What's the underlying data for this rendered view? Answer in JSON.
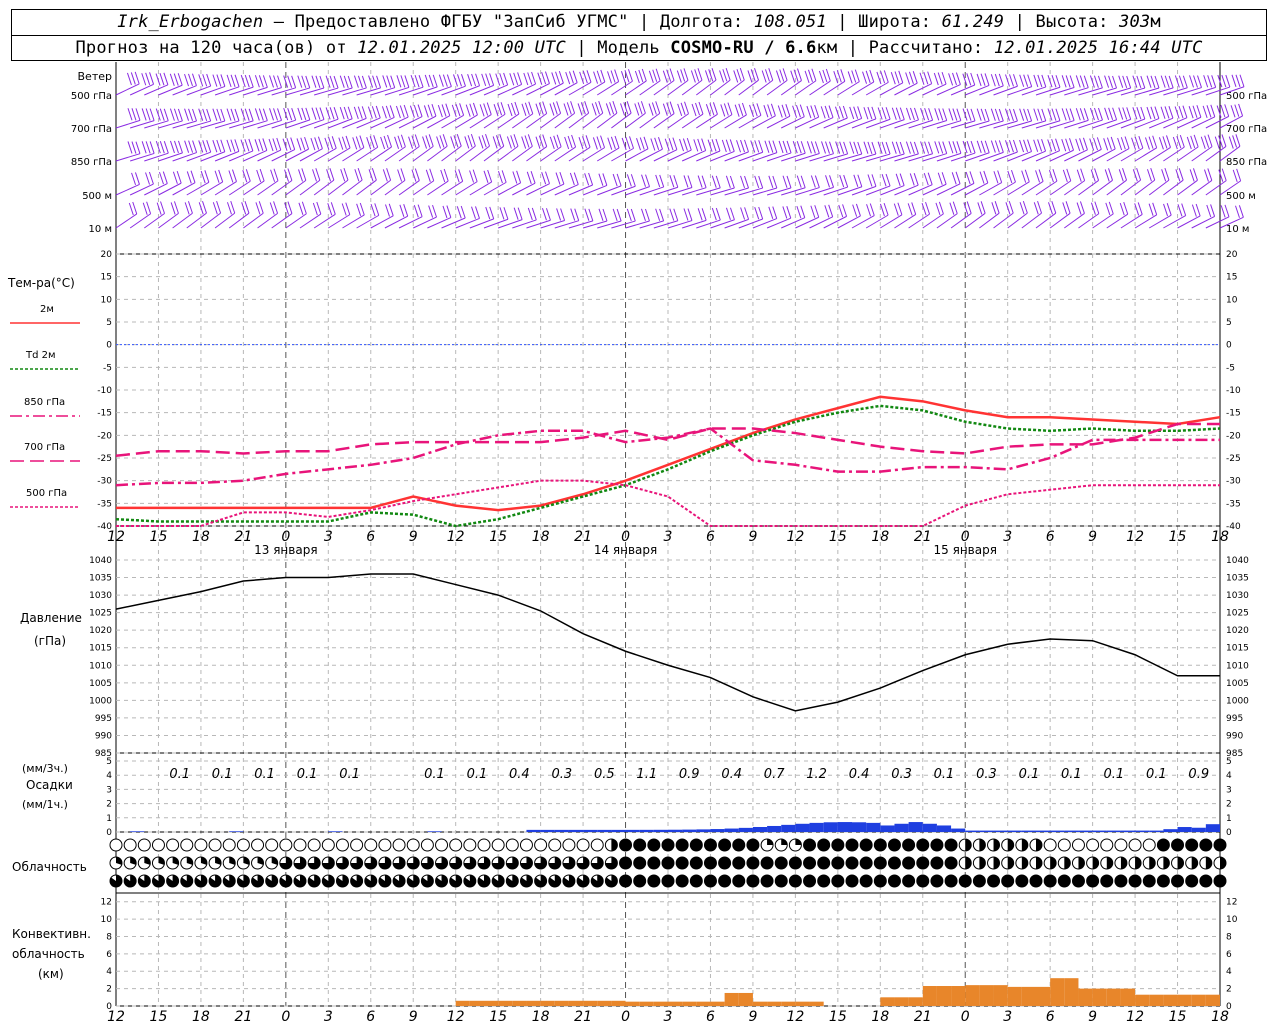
{
  "header": {
    "station": "Irk_Erbogachen",
    "provider": "– Предоставлено ФГБУ \"ЗапСиб УГМС\"",
    "lon_label": "Долгота:",
    "lon_value": "108.051",
    "lat_label": "Широта:",
    "lat_value": "61.249",
    "alt_label": "Высота:",
    "alt_value": "303",
    "alt_unit": "м",
    "forecast_label": "Прогноз на 120 часа(ов) от",
    "forecast_time": "12.01.2025 12:00 UTC",
    "model_label": "Модель",
    "model_name": "COSMO-RU / 6.6",
    "model_unit": "км",
    "calc_label": "Рассчитано:",
    "calc_time": "12.01.2025 16:44 UTC"
  },
  "colors": {
    "temp2m": "#ff3333",
    "td2m": "#118811",
    "hpa850": "#e8147a",
    "hpa700": "#e8147a",
    "hpa500": "#e8147a",
    "wind": "#8a2be2",
    "precip": "#1f3fe0",
    "conv": "#e8862a",
    "zero": "#3355ff"
  },
  "chart_data": [
    {
      "type": "wind-barbs",
      "title": "Ветер",
      "levels": [
        "500 гПа",
        "700 гПа",
        "850 гПа",
        "500 м",
        "10 м"
      ]
    },
    {
      "type": "line",
      "title": "Тем-ра(°C)",
      "ylim": [
        -40,
        20
      ],
      "yticks": [
        20,
        15,
        10,
        5,
        0,
        -5,
        -10,
        -15,
        -20,
        -25,
        -30,
        -35,
        -40
      ],
      "x_hours": [
        0,
        3,
        6,
        9,
        12,
        15,
        18,
        21,
        24,
        27,
        30,
        33,
        36,
        39,
        42,
        45,
        48,
        51,
        54,
        57,
        60,
        63,
        66,
        69,
        72,
        75,
        78,
        81,
        84,
        87,
        90
      ],
      "series": [
        {
          "name": "2м",
          "values": [
            -36,
            -36,
            -36,
            -36,
            -36,
            -36,
            -36,
            -33.5,
            -35.5,
            -36.5,
            -35.5,
            -33,
            -30,
            -26.5,
            -23,
            -19.5,
            -16.5,
            -14,
            -11.5,
            -12.5,
            -14.5,
            -16,
            -16,
            -16.5,
            -17,
            -17.5,
            -16,
            -16,
            -16,
            -16,
            -16
          ]
        },
        {
          "name": "Td 2м",
          "values": [
            -38.5,
            -39,
            -39,
            -39,
            -39,
            -39,
            -37,
            -37.5,
            -40,
            -38.5,
            -36,
            -33.5,
            -31,
            -27.5,
            -23.5,
            -20,
            -17,
            -15,
            -13.5,
            -14.5,
            -17,
            -18.5,
            -19,
            -18.5,
            -19,
            -19,
            -18.5,
            -18.5,
            -18.5,
            -18.5,
            -18.5
          ]
        },
        {
          "name": "850 гПа",
          "values": [
            -31,
            -30.5,
            -30.5,
            -30,
            -28.5,
            -27.5,
            -26.5,
            -25,
            -22,
            -20,
            -19,
            -19,
            -21.5,
            -20.5,
            -18.5,
            -25.5,
            -26.5,
            -28,
            -28,
            -27,
            -27,
            -27.5,
            -25,
            -21,
            -21,
            -21,
            -21,
            -21,
            -21,
            -21,
            -21
          ]
        },
        {
          "name": "700 гПа",
          "values": [
            -24.5,
            -23.5,
            -23.5,
            -24,
            -23.5,
            -23.5,
            -22,
            -21.5,
            -21.5,
            -21.5,
            -21.5,
            -20.5,
            -19,
            -21,
            -18.5,
            -18.5,
            -19.5,
            -21,
            -22.5,
            -23.5,
            -24,
            -22.5,
            -22,
            -22,
            -20.5,
            -17.5,
            -17.5,
            -17.5,
            -17.5,
            -17.5,
            -17.5
          ]
        },
        {
          "name": "500 гПа",
          "values": [
            -40,
            -40,
            -40,
            -37,
            -37,
            -38,
            -36.5,
            -34.5,
            -33,
            -31.5,
            -30,
            -30,
            -31,
            -33.5,
            -40,
            -40,
            -40,
            -40,
            -40,
            -40,
            -35.5,
            -33,
            -32,
            -31,
            -31,
            -31,
            -31,
            -31,
            -31,
            -31,
            -31
          ]
        }
      ]
    },
    {
      "type": "line",
      "title": "Давление",
      "ylabel": "(гПа)",
      "ylim": [
        985,
        1040
      ],
      "yticks": [
        1040,
        1035,
        1030,
        1025,
        1020,
        1015,
        1010,
        1005,
        1000,
        995,
        990,
        985
      ],
      "x_hours": [
        0,
        3,
        6,
        9,
        12,
        15,
        18,
        21,
        24,
        27,
        30,
        33,
        36,
        39,
        42,
        45,
        48,
        51,
        54,
        57,
        60,
        63,
        66,
        69,
        72,
        75,
        78,
        81,
        84,
        87,
        90
      ],
      "values": [
        1026,
        1028.5,
        1031,
        1034,
        1035,
        1035,
        1036,
        1036,
        1033,
        1030,
        1025.5,
        1019,
        1014,
        1010,
        1006.5,
        1001,
        997,
        999.5,
        1003.5,
        1008.5,
        1013,
        1016,
        1017.5,
        1017,
        1013,
        1007,
        1007,
        1007,
        1007,
        1007,
        1007
      ]
    },
    {
      "type": "bar",
      "title": "Осадки",
      "ylabel_3h": "(мм/3ч.)",
      "ylabel_1h": "(мм/1ч.)",
      "ylim": [
        0,
        5
      ],
      "yticks": [
        5,
        4,
        3,
        2,
        1,
        0
      ],
      "totals_3h": [
        "0.1",
        "0.1",
        "0.1",
        "0.1",
        "0.1",
        "",
        "0.1",
        "0.1",
        "0.4",
        "0.3",
        "0.5",
        "1.1",
        "0.9",
        "0.4",
        "0.7",
        "1.2",
        "0.4",
        "0.3",
        "0.1",
        "0.3",
        "0.1",
        "0.1",
        "0.1",
        "0.1",
        "0.9"
      ],
      "hourly": [
        0,
        0,
        0,
        0,
        0,
        0,
        0,
        0,
        0,
        0,
        0,
        0,
        0,
        0,
        0,
        0,
        0,
        0,
        0,
        0,
        0,
        0,
        0,
        0,
        0,
        0,
        0,
        0,
        0,
        0,
        0,
        0,
        0,
        0,
        0,
        0,
        0,
        0,
        0,
        0,
        0.02,
        0.02,
        0.02,
        0.02,
        0.02,
        0.02,
        0.02,
        0.02,
        0.02,
        0.02,
        0.02,
        0.02,
        0.02,
        0.02,
        0.02,
        0.02,
        0.02,
        0.02,
        0.02,
        0.02,
        0.02,
        0.02,
        0.02,
        0.02,
        0.02,
        0.02,
        0.02,
        0.02,
        0.02,
        0.02,
        0.02,
        0.02,
        0.02,
        0.02,
        0.02,
        0.02,
        0.02,
        0.02,
        0.02,
        0.02,
        0.02,
        0.02,
        0.02,
        0.02,
        0.02,
        0.02,
        0.02,
        0.02,
        0.02,
        0.02,
        0.02,
        0.02,
        0.02,
        0.02,
        0.02,
        0.02,
        0.02,
        0.02,
        0.02,
        0.02,
        0.02,
        0.02,
        0.02,
        0.02,
        0.02,
        0.02,
        0.02,
        0.02,
        0.02,
        0.02,
        0.02,
        0.02,
        0.02,
        0.02,
        0.02,
        0.02,
        0.02,
        0.02,
        0.02,
        0.02
      ]
    },
    {
      "type": "cloud-cover",
      "title": "Облачность",
      "rows": 3
    },
    {
      "type": "bar",
      "title": "Конвективн. облачность",
      "ylabel": "(км)",
      "ylim": [
        0,
        13
      ],
      "yticks": [
        12,
        10,
        8,
        6,
        4,
        2,
        0
      ],
      "hourly_note": "convective cloud top height (km)"
    }
  ],
  "axes": {
    "hour_labels": [
      "12",
      "15",
      "18",
      "21",
      "0",
      "3",
      "6",
      "9",
      "12",
      "15",
      "18",
      "21",
      "0",
      "3",
      "6",
      "9",
      "12",
      "15",
      "18",
      "21",
      "0",
      "3",
      "6",
      "9",
      "12",
      "15",
      "18"
    ],
    "day_labels": [
      "13 января",
      "14 января",
      "15 января"
    ]
  }
}
